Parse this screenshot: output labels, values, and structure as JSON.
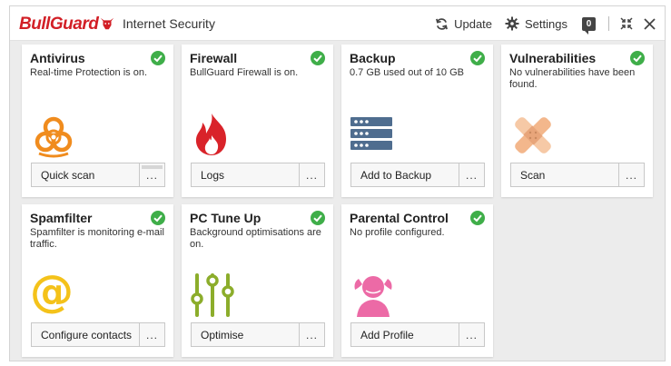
{
  "app": {
    "brand": "BullGuard",
    "product": "Internet Security"
  },
  "toolbar": {
    "update_label": "Update",
    "settings_label": "Settings",
    "messages_count": "0"
  },
  "colors": {
    "brand_red": "#d21f26",
    "check_green": "#3fae49",
    "antivirus_orange": "#f08c1e",
    "firewall_red": "#d9232a",
    "backup_blue": "#4f6d8f",
    "vuln_peach": "#f3b78c",
    "spam_yellow": "#f4c21a",
    "tuneup_green": "#8cad2b",
    "parental_pink": "#ec6aa6"
  },
  "tiles": [
    {
      "title": "Antivirus",
      "desc": "Real-time Protection is on.",
      "icon": "biohazard-icon",
      "action": "Quick scan",
      "more": "..."
    },
    {
      "title": "Firewall",
      "desc": "BullGuard Firewall is on.",
      "icon": "flame-icon",
      "action": "Logs",
      "more": "..."
    },
    {
      "title": "Backup",
      "desc": "0.7 GB used out of 10 GB",
      "icon": "server-stack-icon",
      "action": "Add to Backup",
      "more": "..."
    },
    {
      "title": "Vulnerabilities",
      "desc": "No vulnerabilities have been found.",
      "icon": "bandage-icon",
      "action": "Scan",
      "more": "..."
    },
    {
      "title": "Spamfilter",
      "desc": "Spamfilter is monitoring e-mail traffic.",
      "icon": "at-sign-icon",
      "action": "Configure contacts",
      "more": "..."
    },
    {
      "title": "PC Tune Up",
      "desc": "Background optimisations are on.",
      "icon": "sliders-icon",
      "action": "Optimise",
      "more": "..."
    },
    {
      "title": "Parental Control",
      "desc": "No profile configured.",
      "icon": "child-icon",
      "action": "Add Profile",
      "more": "..."
    }
  ],
  "glyphs": {
    "at": "@"
  }
}
